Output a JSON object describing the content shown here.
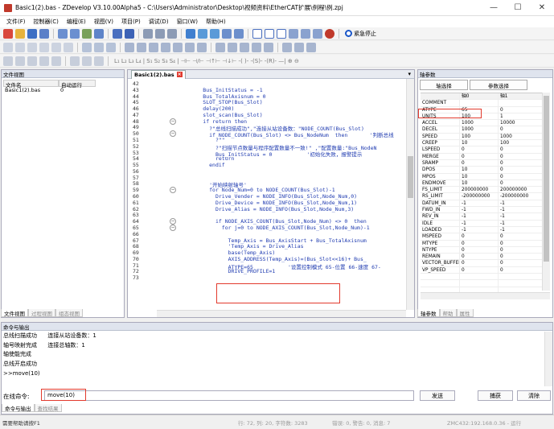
{
  "window": {
    "title": "Basic1(2).bas - ZDevelop V3.10.00Alpha5 - C:\\Users\\Administrator\\Desktop\\视频资料\\EtherCAT扩展\\例程\\例.zpj",
    "minimize": "—",
    "maximize": "☐",
    "close": "✕"
  },
  "menu": [
    "文件(F)",
    "控制器(C)",
    "编程(E)",
    "视图(V)",
    "项目(P)",
    "调试(D)",
    "窗口(W)",
    "帮助(H)"
  ],
  "toolbar": {
    "estop_label": "紧急停止",
    "icons": [
      "new-file-icon",
      "open-folder-icon",
      "save-icon",
      "save-all-icon",
      "controller-icon"
    ],
    "row2_text": "L₁ L₂ L₃ L₄ | S₁ S₂ S₃ S₄ | ⊣⊢ ⊣/⊢ ⊣↑⊢ ⊣↓⊢ -( )- -(S)- -(R)- —| ⊕ ⊖"
  },
  "colors": {
    "highlight": "#e23a2d",
    "code_text": "#1f3bb0",
    "accent": "#1a56c8"
  },
  "file_view": {
    "title": "文件视图",
    "columns": [
      "文件名",
      "自动运行"
    ],
    "rows": [
      {
        "name": "Basic1(2).bas",
        "auto": "0"
      }
    ],
    "tabs": [
      "文件视图",
      "过程视图",
      "组态视图"
    ]
  },
  "editor": {
    "tab": "Basic1(2).bas",
    "dropdown": "▾",
    "lines": [
      {
        "n": 42,
        "t": ""
      },
      {
        "n": 43,
        "t": "        Bus_InitStatus = -1"
      },
      {
        "n": 44,
        "t": "        Bus_TotalAxisnum = 0"
      },
      {
        "n": 45,
        "t": "        SLOT_STOP(Bus_Slot)"
      },
      {
        "n": 46,
        "t": "        delay(200)"
      },
      {
        "n": 47,
        "t": "        slot_scan(Bus_Slot)"
      },
      {
        "n": 48,
        "t": "        if return then"
      },
      {
        "n": 49,
        "t": "          ?\"总线扫描成功\",\"连接从站设备数：\"NODE_COUNT(Bus_Slot)"
      },
      {
        "n": 50,
        "t": "          if NODE_COUNT(Bus_Slot) <> Bus_NodeNum  then       '判断总线"
      },
      {
        "n": 51,
        "t": "            ?\"\""
      },
      {
        "n": 52,
        "t": "            ?\"扫描节点数量与程序配置数量不一致!\" ,\"配置数量:\"Bus_NodeN"
      },
      {
        "n": 53,
        "t": "            Bus_InitStatus = 0           '初始化失败，报警提示"
      },
      {
        "n": 54,
        "t": "            return"
      },
      {
        "n": 55,
        "t": "          endif"
      },
      {
        "n": 56,
        "t": ""
      },
      {
        "n": 57,
        "t": ""
      },
      {
        "n": 58,
        "t": "          '开始映射轴号'"
      },
      {
        "n": 59,
        "t": "          for Node_Num=0 to NODE_COUNT(Bus_Slot)-1"
      },
      {
        "n": 60,
        "t": "            Drive_Vender = NODE_INFO(Bus_Slot,Node_Num,0)"
      },
      {
        "n": 61,
        "t": "            Drive_Device = NODE_INFO(Bus_Slot,Node_Num,1)"
      },
      {
        "n": 62,
        "t": "            Drive_Alias = NODE_INFO(Bus_Slot,Node_Num,3)"
      },
      {
        "n": 63,
        "t": ""
      },
      {
        "n": 64,
        "t": "            if NODE_AXIS_COUNT(Bus_Slot,Node_Num) <> 0  then"
      },
      {
        "n": 65,
        "t": "              for j=0 to NODE_AXIS_COUNT(Bus_Slot,Node_Num)-1"
      },
      {
        "n": 66,
        "t": ""
      },
      {
        "n": 67,
        "t": "                Temp_Axis = Bus_AxisStart + Bus_TotalAxisnum"
      },
      {
        "n": 68,
        "t": "                'Temp_Axis = Drive_Alias"
      },
      {
        "n": 69,
        "t": "                base(Temp_Axis)"
      },
      {
        "n": 70,
        "t": "                AXIS_ADDRESS(Temp_Axis)=(Bus_Slot<<16)+ Bus_"
      },
      {
        "n": 71,
        "t": "                ATYPE=65           '设置控制模式 65-位置 66-速度 67-"
      },
      {
        "n": 72,
        "t": "                DRIVE_PROFILE=1"
      },
      {
        "n": 73,
        "t": ""
      }
    ]
  },
  "axis_params": {
    "title": "轴参数",
    "btn_axis": "轴选择",
    "btn_param": "参数选择",
    "columns": [
      "",
      "轴0",
      "轴1"
    ],
    "rows": [
      [
        "COMMENT",
        "",
        ""
      ],
      [
        "ATYPE",
        "65",
        "0"
      ],
      [
        "UNITS",
        "100",
        "1"
      ],
      [
        "ACCEL",
        "1000",
        "10000"
      ],
      [
        "DECEL",
        "1000",
        "0"
      ],
      [
        "SPEED",
        "100",
        "1000"
      ],
      [
        "CREEP",
        "10",
        "100"
      ],
      [
        "LSPEED",
        "0",
        "0"
      ],
      [
        "MERGE",
        "0",
        "0"
      ],
      [
        "SRAMP",
        "0",
        "0"
      ],
      [
        "DPOS",
        "10",
        "0"
      ],
      [
        "MPOS",
        "10",
        "0"
      ],
      [
        "ENDMOVE",
        "10",
        "0"
      ],
      [
        "FS_LIMIT",
        "200000000",
        "200000000"
      ],
      [
        "RS_LIMIT",
        "-200000000",
        "-200000000"
      ],
      [
        "DATUM_IN",
        "-1",
        "-1"
      ],
      [
        "FWD_IN",
        "-1",
        "-1"
      ],
      [
        "REV_IN",
        "-1",
        "-1"
      ],
      [
        "IDLE",
        "-1",
        "-1"
      ],
      [
        "LOADED",
        "-1",
        "-1"
      ],
      [
        "MSPEED",
        "0",
        "0"
      ],
      [
        "MTYPE",
        "0",
        "0"
      ],
      [
        "NTYPE",
        "0",
        "0"
      ],
      [
        "REMAIN",
        "0",
        "0"
      ],
      [
        "VECTOR_BUFFERED",
        "0",
        "0"
      ],
      [
        "VP_SPEED",
        "0",
        "0"
      ],
      [
        "",
        "",
        ""
      ],
      [
        "",
        "",
        ""
      ],
      [
        "",
        "",
        ""
      ]
    ],
    "tabs": [
      "轴参数",
      "帮助",
      "属性"
    ]
  },
  "command": {
    "title": "命令与输出",
    "output": "总线扫描成功      连接从站设备数：1\n轴号映射完成      连接总轴数：1\n轴使能完成\n总线开启成功\n>>move(10)",
    "label": "在线命令:",
    "input": "move(10)",
    "send": "发送",
    "capture": "捕获",
    "clear": "清除",
    "tabs": [
      "命令与输出",
      "查找结果"
    ]
  },
  "status": {
    "left": "需要帮助请按F1",
    "pos": "行: 72, 列: 20, 字符数: 3283",
    "errors": "错误: 0, 警告: 0, 消息: 7",
    "conn": "ZMC432:192.168.0.36 - 运行"
  }
}
